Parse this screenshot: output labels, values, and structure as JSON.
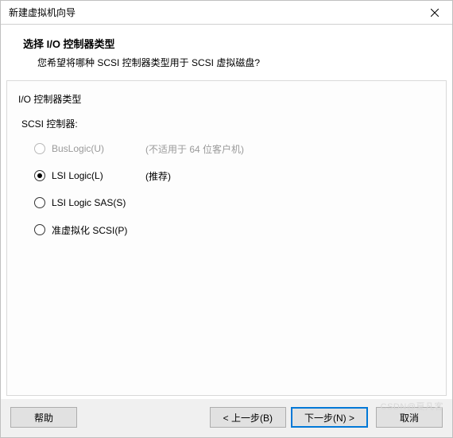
{
  "window": {
    "title": "新建虚拟机向导"
  },
  "header": {
    "title": "选择 I/O 控制器类型",
    "subtitle": "您希望将哪种 SCSI 控制器类型用于 SCSI 虚拟磁盘?"
  },
  "group": {
    "label": "I/O 控制器类型",
    "sub_label": "SCSI 控制器:"
  },
  "options": [
    {
      "label": "BusLogic(U)",
      "note": "(不适用于 64 位客户机)",
      "disabled": true,
      "selected": false
    },
    {
      "label": "LSI Logic(L)",
      "note": "(推荐)",
      "disabled": false,
      "selected": true
    },
    {
      "label": "LSI Logic SAS(S)",
      "note": "",
      "disabled": false,
      "selected": false
    },
    {
      "label": "准虚拟化 SCSI(P)",
      "note": "",
      "disabled": false,
      "selected": false
    }
  ],
  "footer": {
    "help": "帮助",
    "back": "< 上一步(B)",
    "next": "下一步(N) >",
    "cancel": "取消"
  },
  "watermark": "CSDN@夏凡客"
}
